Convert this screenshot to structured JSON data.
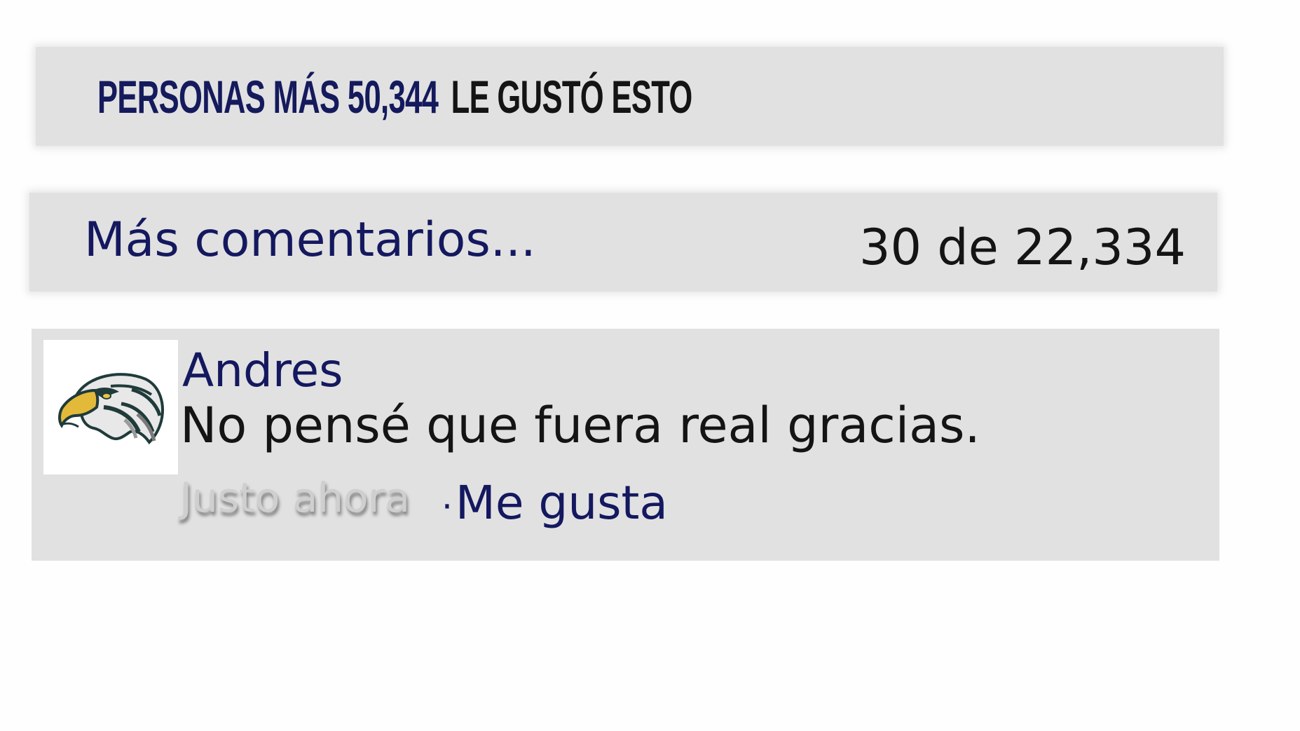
{
  "likes_bar": {
    "prefix": "PERSONAS MÁS 50,344",
    "suffix": "LE GUSTÓ ESTO"
  },
  "more_comments": {
    "link_label": "Más comentarios...",
    "count": "30 de 22,334"
  },
  "comment": {
    "author": "Andres",
    "text": "No pensé que fuera real gracias.",
    "time": "Justo ahora",
    "like_separator": "·",
    "like_label": "Me gusta",
    "avatar_icon": "eagle-icon"
  },
  "colors": {
    "navy": "#14185f",
    "panel_gray": "#e1e1e1",
    "text_dark": "#141414",
    "timestamp_gray": "#cfcfcf"
  }
}
